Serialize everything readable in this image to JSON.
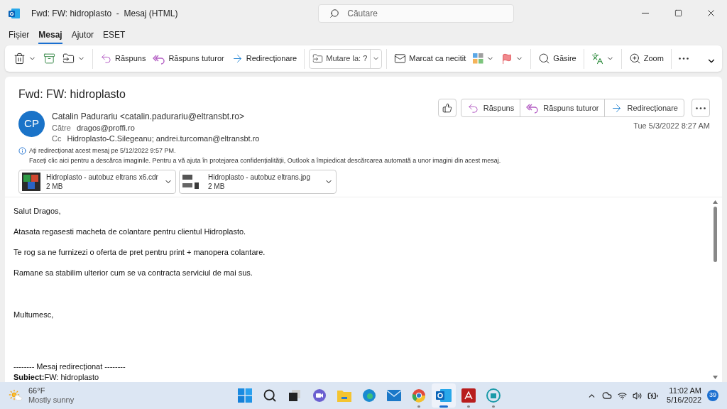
{
  "window": {
    "title": "Fwd: FW: hidroplasto  -  Mesaj (HTML)"
  },
  "search": {
    "placeholder": "Căutare"
  },
  "menu": [
    {
      "label": "Fișier",
      "selected": false
    },
    {
      "label": "Mesaj",
      "selected": true
    },
    {
      "label": "Ajutor",
      "selected": false
    },
    {
      "label": "ESET",
      "selected": false
    }
  ],
  "toolbar": [
    {
      "kind": "delete"
    },
    {
      "kind": "archive"
    },
    {
      "kind": "move"
    },
    {
      "kind": "divider"
    },
    {
      "kind": "reply",
      "label": "Răspuns"
    },
    {
      "kind": "reply_all",
      "label": "Răspuns tuturor"
    },
    {
      "kind": "forward",
      "label": "Redirecționare"
    },
    {
      "kind": "divider"
    },
    {
      "kind": "move_field",
      "label": "Mutare la: ?"
    },
    {
      "kind": "divider"
    },
    {
      "kind": "unread",
      "label": "Marcat ca necitit"
    },
    {
      "kind": "categorize"
    },
    {
      "kind": "flag"
    },
    {
      "kind": "divider"
    },
    {
      "kind": "find",
      "label": "Găsire"
    },
    {
      "kind": "divider"
    },
    {
      "kind": "translate"
    },
    {
      "kind": "divider"
    },
    {
      "kind": "zoom",
      "label": "Zoom"
    },
    {
      "kind": "divider"
    },
    {
      "kind": "more"
    }
  ],
  "message": {
    "subject": "Fwd: FW: hidroplasto",
    "initials": "CP",
    "from": "Catalin Padurariu <catalin.padurariu@eltransbt.ro>",
    "to_label": "Către",
    "to": "dragos@proffi.ro",
    "cc_label": "Cc",
    "cc": "Hidroplasto-C.Silegeanu; andrei.turcoman@eltransbt.ro",
    "info": "Ați redirecționat acest mesaj pe 5/12/2022 9:57 PM.",
    "images_notice": "Faceți clic aici pentru a descărca imaginile. Pentru a vă ajuta în protejarea confidențialității, Outlook a împiedicat descărcarea automată a unor imagini din acest mesaj.",
    "actions": [
      {
        "kind": "reply",
        "label": "Răspuns"
      },
      {
        "kind": "reply_all",
        "label": "Răspuns tuturor"
      },
      {
        "kind": "forward",
        "label": "Redirecționare"
      }
    ],
    "date": "Tue 5/3/2022 8:27 AM",
    "attachments": [
      {
        "kind": "cdr",
        "name": "Hidroplasto - autobuz eltrans x6.cdr",
        "size": "2 MB"
      },
      {
        "kind": "jpg",
        "name": "Hidroplasto - autobuz eltrans.jpg",
        "size": "2 MB"
      }
    ]
  },
  "body": [
    {
      "kind": "paragraph",
      "text": "Salut Dragos,"
    },
    {
      "kind": "paragraph",
      "text": "Atasata regasesti macheta de colantare pentru clientul Hidroplasto."
    },
    {
      "kind": "paragraph",
      "text": "Te rog sa ne furnizezi o oferta de pret pentru print + manopera colantare."
    },
    {
      "kind": "paragraph",
      "text": "Ramane sa stabilim ulterior cum se va contracta serviciul de mai sus."
    },
    {
      "kind": "closing",
      "text": "Multumesc,"
    },
    {
      "kind": "separator",
      "text": "-------- Mesaj redirecționat --------"
    },
    {
      "kind": "header",
      "text": "**Subiect:**FW: hidroplasto"
    }
  ],
  "taskbar": {
    "temperature": "66°F",
    "weather": "Mostly sunny",
    "apps": [
      {
        "kind": "start",
        "running": false,
        "selected": false
      },
      {
        "kind": "search",
        "running": false,
        "selected": false
      },
      {
        "kind": "taskview",
        "running": false,
        "selected": false
      },
      {
        "kind": "chat",
        "running": false,
        "selected": false
      },
      {
        "kind": "files",
        "running": false,
        "selected": false
      },
      {
        "kind": "edge",
        "running": false,
        "selected": false
      },
      {
        "kind": "mail",
        "running": false,
        "selected": false
      },
      {
        "kind": "chrome",
        "running": true,
        "selected": false
      },
      {
        "kind": "outlook",
        "running": true,
        "selected": true
      },
      {
        "kind": "pdf",
        "running": true,
        "selected": false
      },
      {
        "kind": "eset",
        "running": true,
        "selected": false
      }
    ],
    "time": "11:02 AM",
    "date": "5/16/2022",
    "notifications": "39"
  }
}
